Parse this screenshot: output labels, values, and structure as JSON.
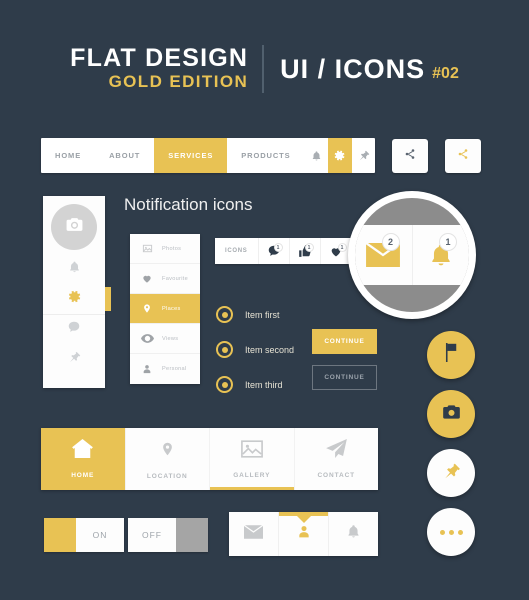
{
  "header": {
    "title_line1": "FLAT DESIGN",
    "title_line2": "GOLD EDITION",
    "title_right": "UI / ICONS",
    "number": "#02"
  },
  "colors": {
    "background": "#2F3C4A",
    "gold": "#E8C254",
    "white": "#FDFDFD",
    "gray_icon": "#C8CACC",
    "magnifier_inner": "#8C8C8C"
  },
  "navbar": {
    "items": [
      {
        "label": "HOME",
        "active": false
      },
      {
        "label": "ABOUT",
        "active": false
      },
      {
        "label": "SERVICES",
        "active": true
      },
      {
        "label": "PRODUCTS",
        "active": false
      }
    ],
    "icons": [
      {
        "name": "bell-icon",
        "active": false
      },
      {
        "name": "gear-icon",
        "active": true
      },
      {
        "name": "pin-icon",
        "active": false
      }
    ]
  },
  "share_buttons": [
    {
      "name": "share-button-gray",
      "icon": "share-icon",
      "color": "#5A6470"
    },
    {
      "name": "share-button-gold",
      "icon": "share-icon",
      "color": "#E8C254"
    }
  ],
  "section": {
    "title": "Notification icons"
  },
  "vertical_sidebar": {
    "avatar_icon": "camera-icon",
    "items": [
      {
        "name": "bell-icon",
        "active": false
      },
      {
        "name": "gear-icon",
        "active": true
      },
      {
        "name": "chat-icon",
        "active": false
      },
      {
        "name": "pin-icon",
        "active": false
      }
    ]
  },
  "menu_list": {
    "items": [
      {
        "label": "Photos",
        "icon": "image-icon",
        "active": false
      },
      {
        "label": "Favourite",
        "icon": "heart-icon",
        "active": false
      },
      {
        "label": "Places",
        "icon": "map-pin-icon",
        "active": true
      },
      {
        "label": "Views",
        "icon": "eye-icon",
        "active": false
      },
      {
        "label": "Personal",
        "icon": "person-icon",
        "active": false
      }
    ]
  },
  "icons_toolbar": {
    "label": "ICONS",
    "cells": [
      {
        "icon": "chat-bubble-icon",
        "badge": "1"
      },
      {
        "icon": "thumbs-up-icon",
        "badge": "1"
      },
      {
        "icon": "heart-icon",
        "badge": "1"
      }
    ]
  },
  "magnifier": {
    "cells": [
      {
        "icon": "envelope-icon",
        "badge": "2"
      },
      {
        "icon": "bell-icon",
        "badge": "1"
      }
    ]
  },
  "radio_list": {
    "items": [
      {
        "label": "Item first",
        "selected": true
      },
      {
        "label": "Item second",
        "selected": true
      },
      {
        "label": "Item third",
        "selected": true
      }
    ]
  },
  "buttons": {
    "continue_filled": "CONTINUE",
    "continue_outlined": "CONTINUE"
  },
  "round_buttons": [
    {
      "name": "flag-button",
      "icon": "flag-icon",
      "style": "gold"
    },
    {
      "name": "camera-button",
      "icon": "camera-icon",
      "style": "gold"
    },
    {
      "name": "pin-button",
      "icon": "pin-icon",
      "style": "white"
    },
    {
      "name": "more-button",
      "icon": "more-dots-icon",
      "style": "white"
    }
  ],
  "tabbar": {
    "tabs": [
      {
        "label": "HOME",
        "icon": "home-icon",
        "active": true,
        "underline": false
      },
      {
        "label": "LOCATION",
        "icon": "map-pin-icon",
        "active": false,
        "underline": false
      },
      {
        "label": "GALLERY",
        "icon": "image-icon",
        "active": false,
        "underline": true
      },
      {
        "label": "CONTACT",
        "icon": "paper-plane-icon",
        "active": false,
        "underline": false
      }
    ]
  },
  "toggles": [
    {
      "name": "toggle-on",
      "label": "ON",
      "state": "on",
      "handle_color": "#E8C254",
      "handle_side": "left"
    },
    {
      "name": "toggle-off",
      "label": "OFF",
      "state": "off",
      "handle_color": "#A5A5A5",
      "handle_side": "right"
    }
  ],
  "bottom_bar": {
    "cells": [
      {
        "icon": "envelope-icon",
        "active": false
      },
      {
        "icon": "person-icon",
        "active": true
      },
      {
        "icon": "bell-icon",
        "active": false
      }
    ]
  }
}
